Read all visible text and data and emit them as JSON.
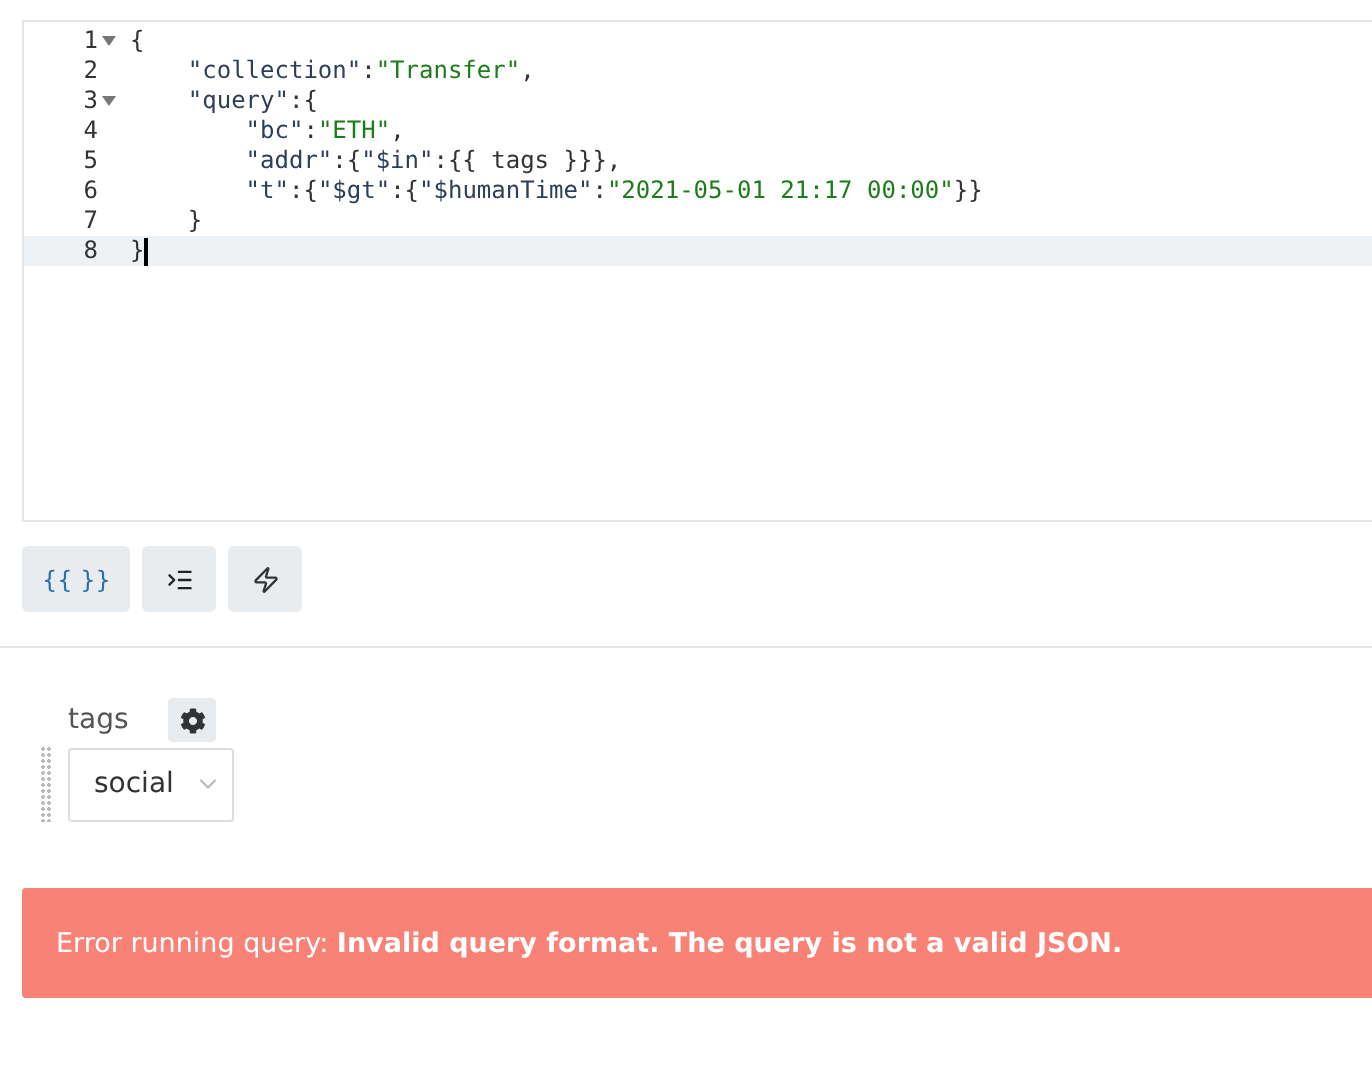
{
  "editor": {
    "lines": [
      {
        "number": "1",
        "foldable": true,
        "active": false,
        "tokens": [
          {
            "kind": "punct",
            "text": "{"
          }
        ]
      },
      {
        "number": "2",
        "foldable": false,
        "active": false,
        "tokens": [
          {
            "kind": "key",
            "text": "    \"collection\""
          },
          {
            "kind": "punct",
            "text": ":"
          },
          {
            "kind": "string",
            "text": "\"Transfer\""
          },
          {
            "kind": "punct",
            "text": ","
          }
        ]
      },
      {
        "number": "3",
        "foldable": true,
        "active": false,
        "tokens": [
          {
            "kind": "key",
            "text": "    \"query\""
          },
          {
            "kind": "punct",
            "text": ":{"
          }
        ]
      },
      {
        "number": "4",
        "foldable": false,
        "active": false,
        "tokens": [
          {
            "kind": "key",
            "text": "        \"bc\""
          },
          {
            "kind": "punct",
            "text": ":"
          },
          {
            "kind": "string",
            "text": "\"ETH\""
          },
          {
            "kind": "punct",
            "text": ","
          }
        ]
      },
      {
        "number": "5",
        "foldable": false,
        "active": false,
        "tokens": [
          {
            "kind": "key",
            "text": "        \"addr\""
          },
          {
            "kind": "punct",
            "text": ":{"
          },
          {
            "kind": "key",
            "text": "\"$in\""
          },
          {
            "kind": "punct",
            "text": ":{{ tags }}},"
          }
        ]
      },
      {
        "number": "6",
        "foldable": false,
        "active": false,
        "tokens": [
          {
            "kind": "key",
            "text": "        \"t\""
          },
          {
            "kind": "punct",
            "text": ":{"
          },
          {
            "kind": "key",
            "text": "\"$gt\""
          },
          {
            "kind": "punct",
            "text": ":{"
          },
          {
            "kind": "key",
            "text": "\"$humanTime\""
          },
          {
            "kind": "punct",
            "text": ":"
          },
          {
            "kind": "string",
            "text": "\"2021-05-01 21:17 00:00\""
          },
          {
            "kind": "punct",
            "text": "}}"
          }
        ]
      },
      {
        "number": "7",
        "foldable": false,
        "active": false,
        "tokens": [
          {
            "kind": "punct",
            "text": "    }"
          }
        ]
      },
      {
        "number": "8",
        "foldable": false,
        "active": true,
        "tokens": [
          {
            "kind": "punct",
            "text": "}"
          }
        ]
      }
    ]
  },
  "toolbar": [
    {
      "kind": "text",
      "label": "{{ }}"
    },
    {
      "kind": "format"
    },
    {
      "kind": "bolt"
    }
  ],
  "parameter": {
    "label": "tags",
    "value": "social"
  },
  "error": {
    "text": "Error running query: **Invalid query format. The query is not a valid JSON.**"
  }
}
